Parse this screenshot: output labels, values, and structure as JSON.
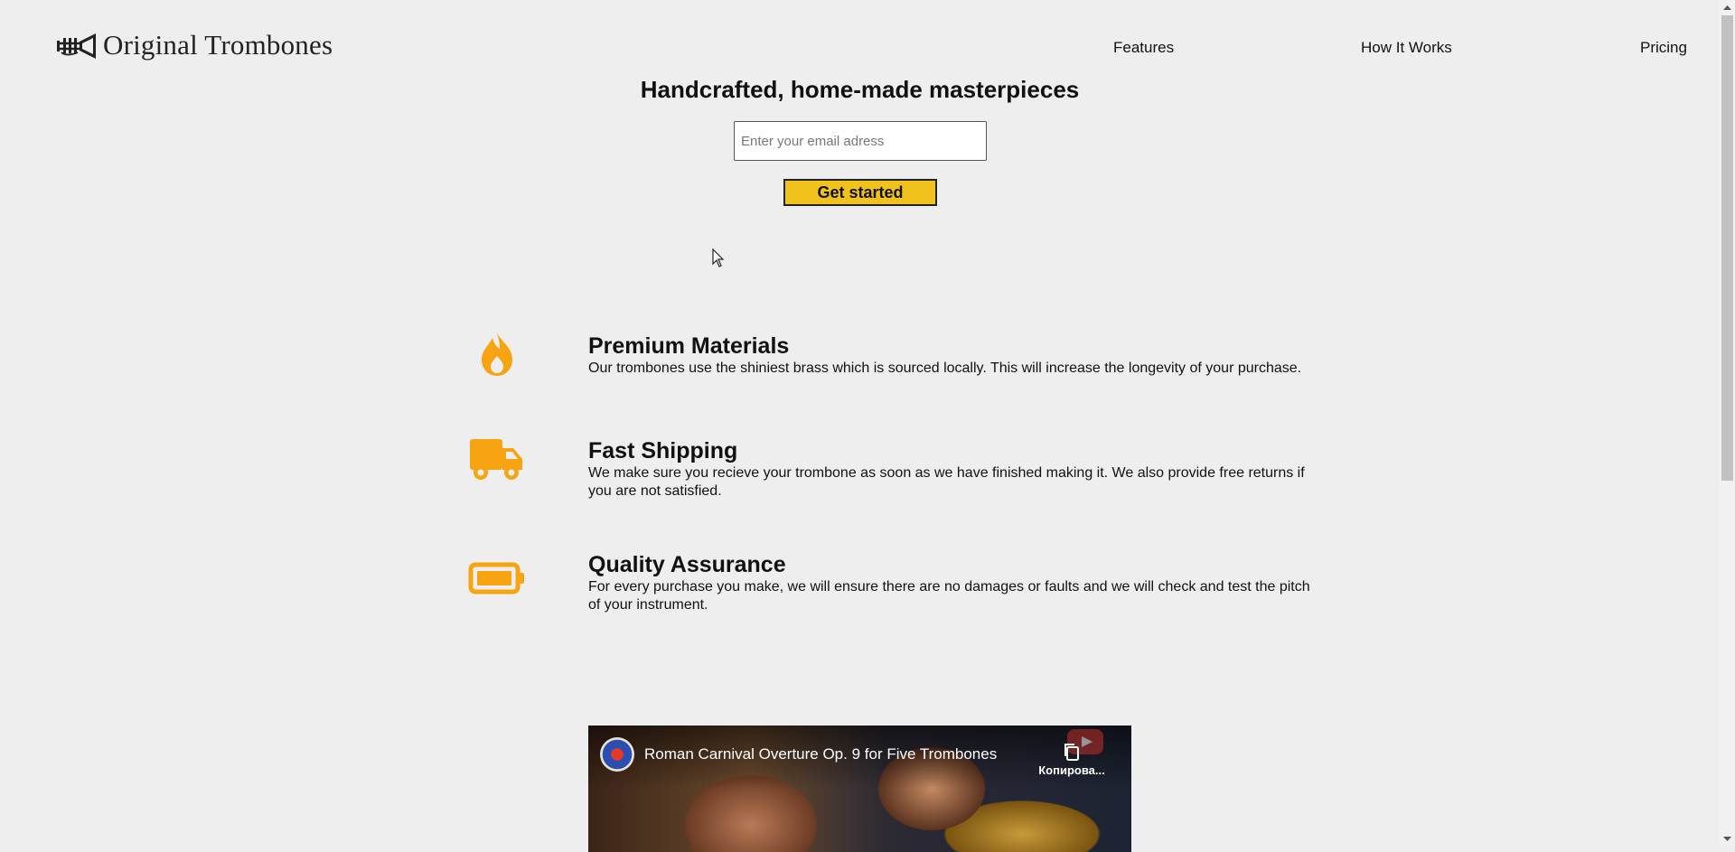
{
  "brand": {
    "name": "Original Trombones",
    "logo_icon": "trumpet-logo-icon"
  },
  "nav": [
    {
      "label": "Features"
    },
    {
      "label": "How It Works"
    },
    {
      "label": "Pricing"
    }
  ],
  "hero": {
    "title": "Handcrafted, home-made masterpieces",
    "email_placeholder": "Enter your email adress",
    "cta_label": "Get started"
  },
  "features": [
    {
      "icon": "flame-icon",
      "title": "Premium Materials",
      "desc": "Our trombones use the shiniest brass which is sourced locally. This will increase the longevity of your purchase."
    },
    {
      "icon": "truck-icon",
      "title": "Fast Shipping",
      "desc": "We make sure you recieve your trombone as soon as we have finished making it. We also provide free returns if you are not satisfied."
    },
    {
      "icon": "battery-icon",
      "title": "Quality Assurance",
      "desc": "For every purchase you make, we will ensure there are no damages or faults and we will check and test the pitch of your instrument."
    }
  ],
  "video": {
    "title": "Roman Carnival Overture Op. 9 for Five Trombones",
    "copy_label": "Копирова..."
  },
  "colors": {
    "accent": "#f1c21b",
    "icon": "#f7a412",
    "background": "#eeeeee"
  }
}
